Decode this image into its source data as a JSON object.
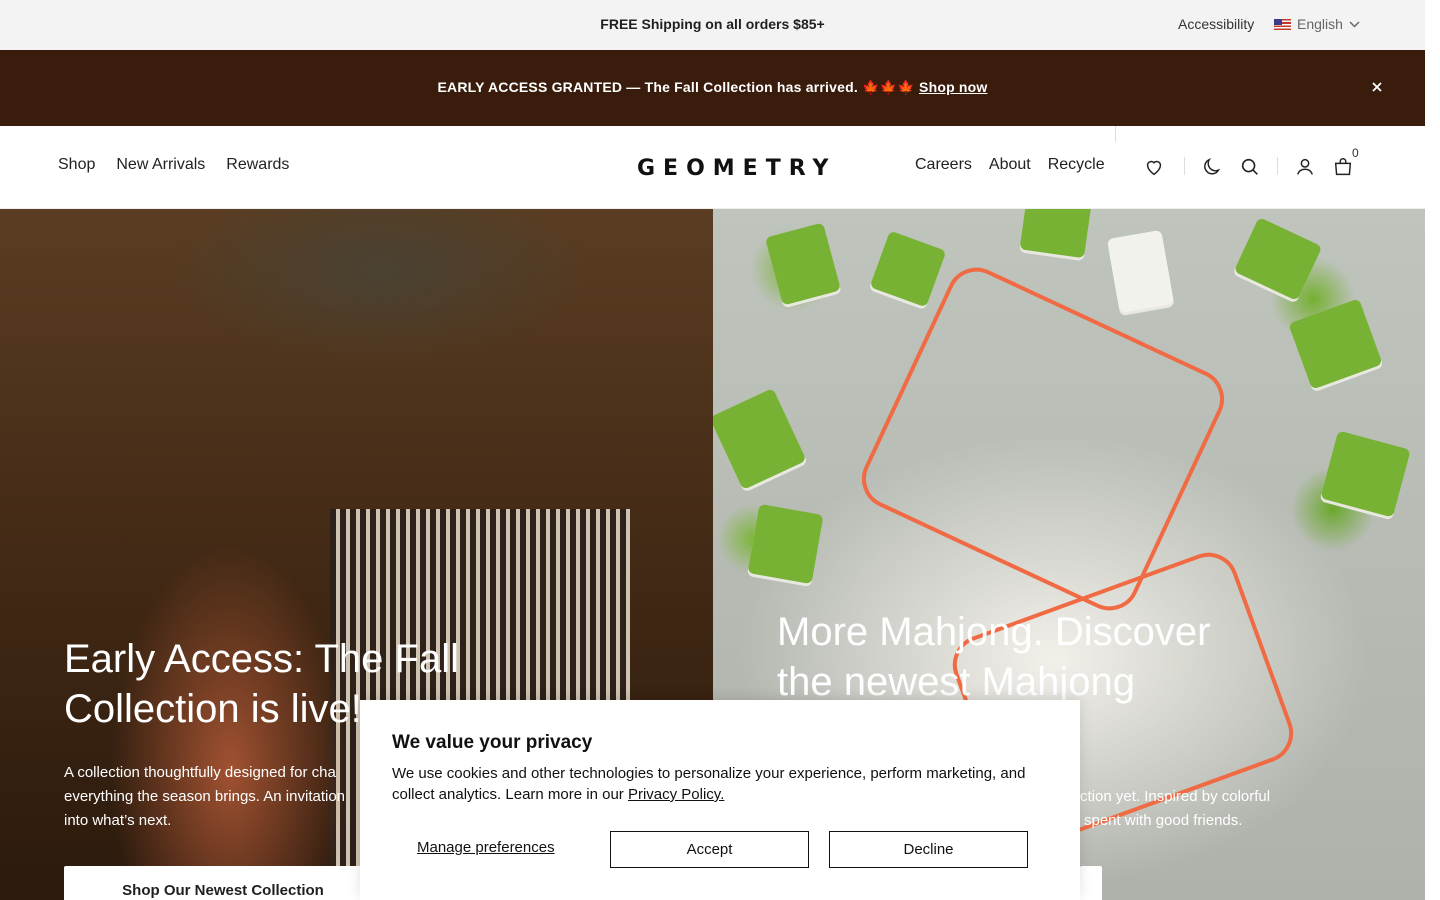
{
  "topbar": {
    "shipping_text": "FREE Shipping on all orders $85+",
    "accessibility_label": "Accessibility",
    "language_label": "English"
  },
  "announcement": {
    "text": "EARLY ACCESS GRANTED — The Fall Collection has arrived.",
    "emoji": "🍁🍁🍁",
    "link_label": "Shop now"
  },
  "header": {
    "nav_left": [
      "Shop",
      "New Arrivals",
      "Rewards"
    ],
    "logo": "GEOMETRY",
    "nav_right": [
      "Careers",
      "About",
      "Recycle"
    ],
    "cart_count": "0",
    "icons": [
      "heart-icon",
      "moon-icon",
      "search-icon",
      "user-icon",
      "bag-icon"
    ]
  },
  "hero": {
    "left": {
      "title": "Early Access: The Fall Collection is live!",
      "description": "A collection thoughtfully designed for cha everything the season brings. An invitation into what’s next.",
      "desc_lines": [
        "A collection thoughtfully designed for cha",
        "everything the season brings. An invitation",
        "into what’s next."
      ],
      "button_label": "Shop Our Newest Collection"
    },
    "right": {
      "title_lines": [
        "More Mahjong. Discover",
        "the newest Mahjong"
      ],
      "desc_lines": [
        "ction yet. Inspired by colorful",
        "spent with good friends."
      ]
    }
  },
  "cookie": {
    "title": "We value your privacy",
    "body": "We use cookies and other technologies to personalize your experience, perform marketing, and collect analytics. Learn more in our",
    "policy_link": "Privacy Policy.",
    "manage_label": "Manage preferences",
    "accept_label": "Accept",
    "decline_label": "Decline"
  },
  "colors": {
    "announcement_bg": "#3a1c0c",
    "topbar_bg": "#f3f3f3",
    "mahjong_green": "#77b234"
  }
}
